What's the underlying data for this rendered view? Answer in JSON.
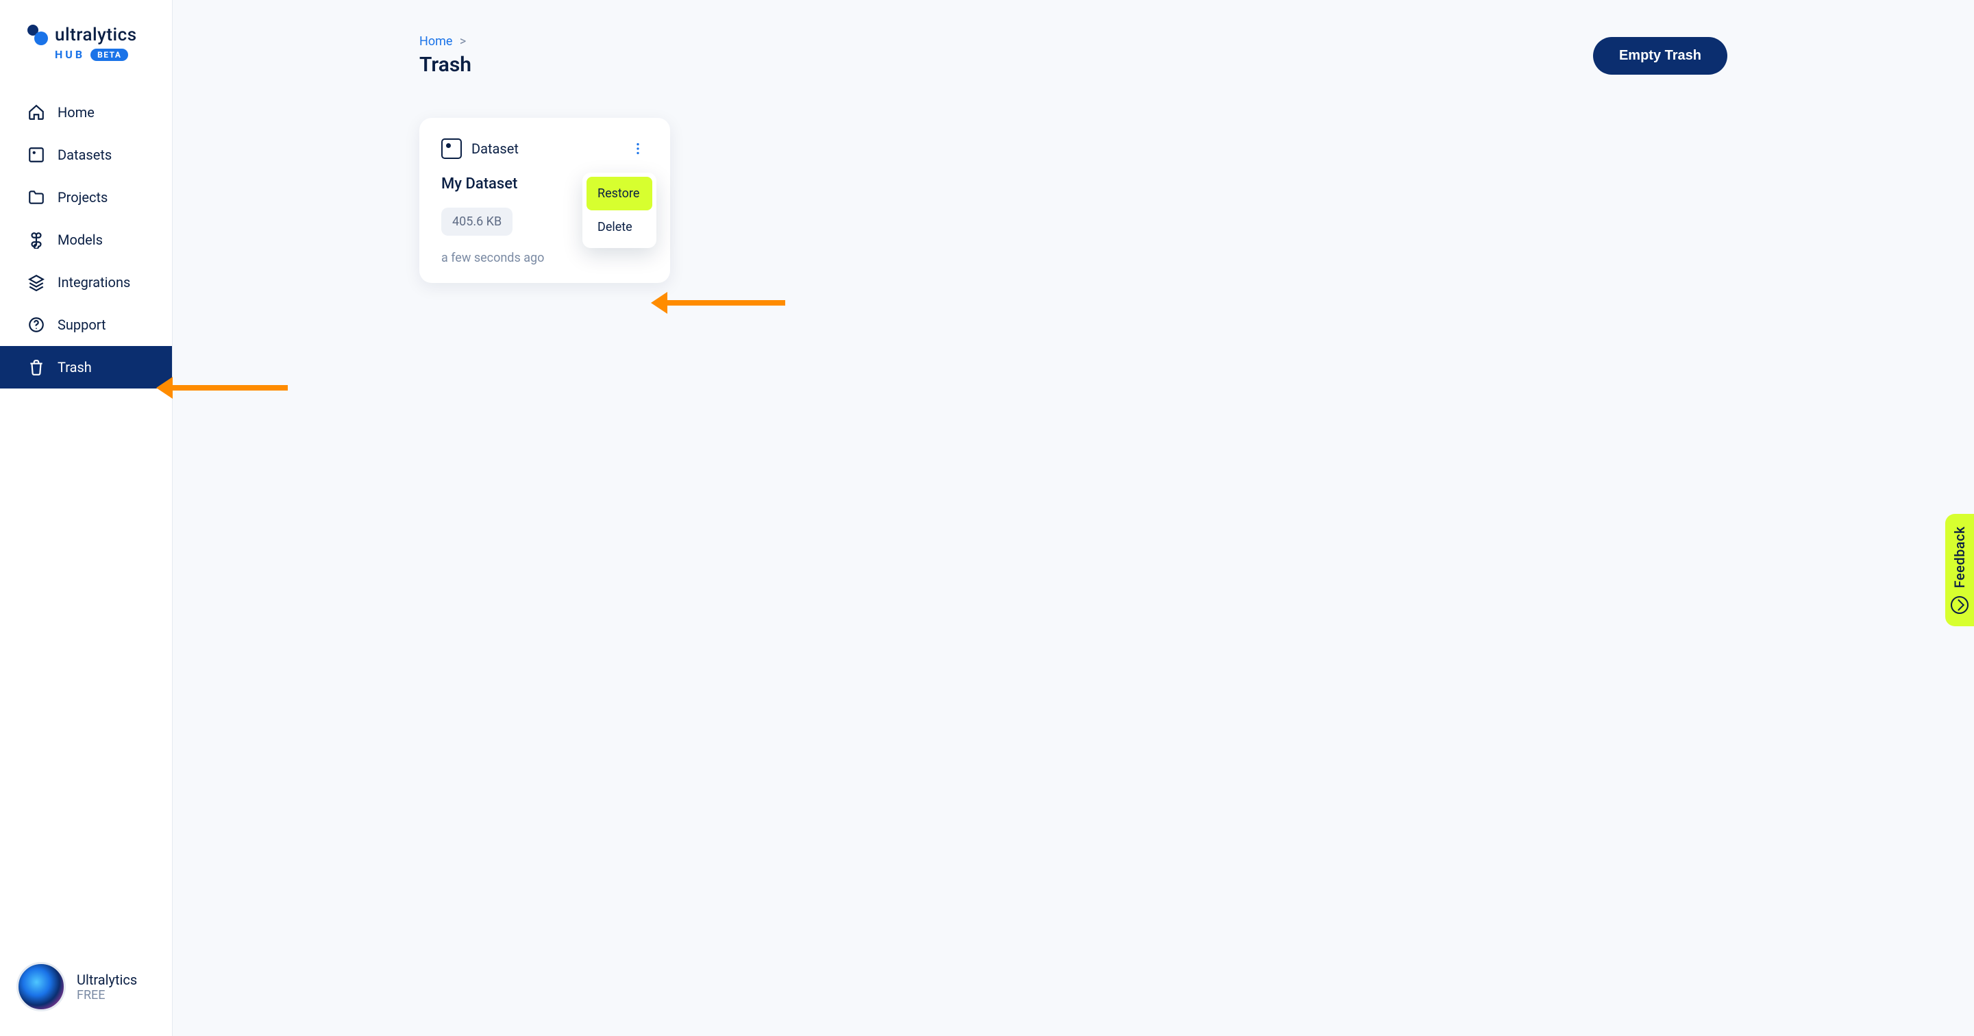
{
  "brand": {
    "name": "ultralytics",
    "hub": "HUB",
    "beta": "BETA"
  },
  "sidebar": {
    "items": [
      {
        "id": "home",
        "label": "Home",
        "icon": "home-icon",
        "active": false
      },
      {
        "id": "datasets",
        "label": "Datasets",
        "icon": "image-icon",
        "active": false
      },
      {
        "id": "projects",
        "label": "Projects",
        "icon": "folder-icon",
        "active": false
      },
      {
        "id": "models",
        "label": "Models",
        "icon": "command-icon",
        "active": false
      },
      {
        "id": "integrations",
        "label": "Integrations",
        "icon": "layers-icon",
        "active": false
      },
      {
        "id": "support",
        "label": "Support",
        "icon": "help-icon",
        "active": false
      },
      {
        "id": "trash",
        "label": "Trash",
        "icon": "trash-icon",
        "active": true
      }
    ]
  },
  "user": {
    "name": "Ultralytics",
    "plan": "FREE"
  },
  "breadcrumbs": {
    "root": "Home",
    "separator": ">"
  },
  "page": {
    "title": "Trash"
  },
  "actions": {
    "empty_trash": "Empty Trash"
  },
  "card": {
    "type": "Dataset",
    "title": "My Dataset",
    "size": "405.6 KB",
    "timestamp": "a few seconds ago"
  },
  "popover": {
    "restore": "Restore",
    "delete": "Delete"
  },
  "feedback": {
    "label": "Feedback"
  },
  "colors": {
    "accent": "#0b2e6f",
    "highlight": "#d7ff2f",
    "annotation": "#ff8c00"
  }
}
